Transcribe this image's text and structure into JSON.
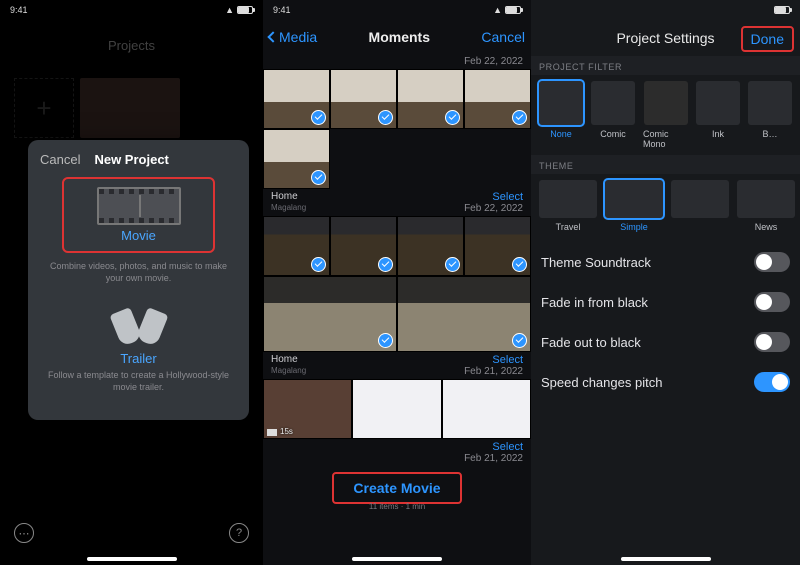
{
  "status": {
    "time": "9:41",
    "wifi": "wifi-icon",
    "battery": "battery-icon"
  },
  "panel1": {
    "projects_title": "Projects",
    "sheet": {
      "cancel": "Cancel",
      "title": "New Project",
      "movie": {
        "label": "Movie",
        "desc": "Combine videos, photos, and music to make your own movie."
      },
      "trailer": {
        "label": "Trailer",
        "desc": "Follow a template to create a Hollywood-style movie trailer."
      }
    },
    "more": "⋯",
    "help": "?"
  },
  "panel2": {
    "back": "Media",
    "title": "Moments",
    "cancel": "Cancel",
    "sections": [
      {
        "date": "Feb 22, 2022"
      },
      {
        "name": "Home",
        "sub": "Magalang",
        "select": "Select",
        "date": "Feb 22, 2022"
      },
      {
        "name": "Home",
        "sub": "Magalang",
        "select": "Select",
        "date": "Feb 21, 2022"
      },
      {
        "select": "Select",
        "date": "Feb 21, 2022"
      }
    ],
    "video_dur": "15s",
    "create": "Create Movie",
    "create_sub": "11 items · 1 min"
  },
  "panel3": {
    "title": "Project Settings",
    "done": "Done",
    "filter_label": "PROJECT FILTER",
    "filters": [
      "None",
      "Comic",
      "Comic Mono",
      "Ink",
      "B…"
    ],
    "theme_label": "THEME",
    "themes": [
      "Travel",
      "Simple",
      "-",
      "News"
    ],
    "rows": {
      "soundtrack": "Theme Soundtrack",
      "fadein": "Fade in from black",
      "fadeout": "Fade out to black",
      "speed": "Speed changes pitch"
    }
  }
}
